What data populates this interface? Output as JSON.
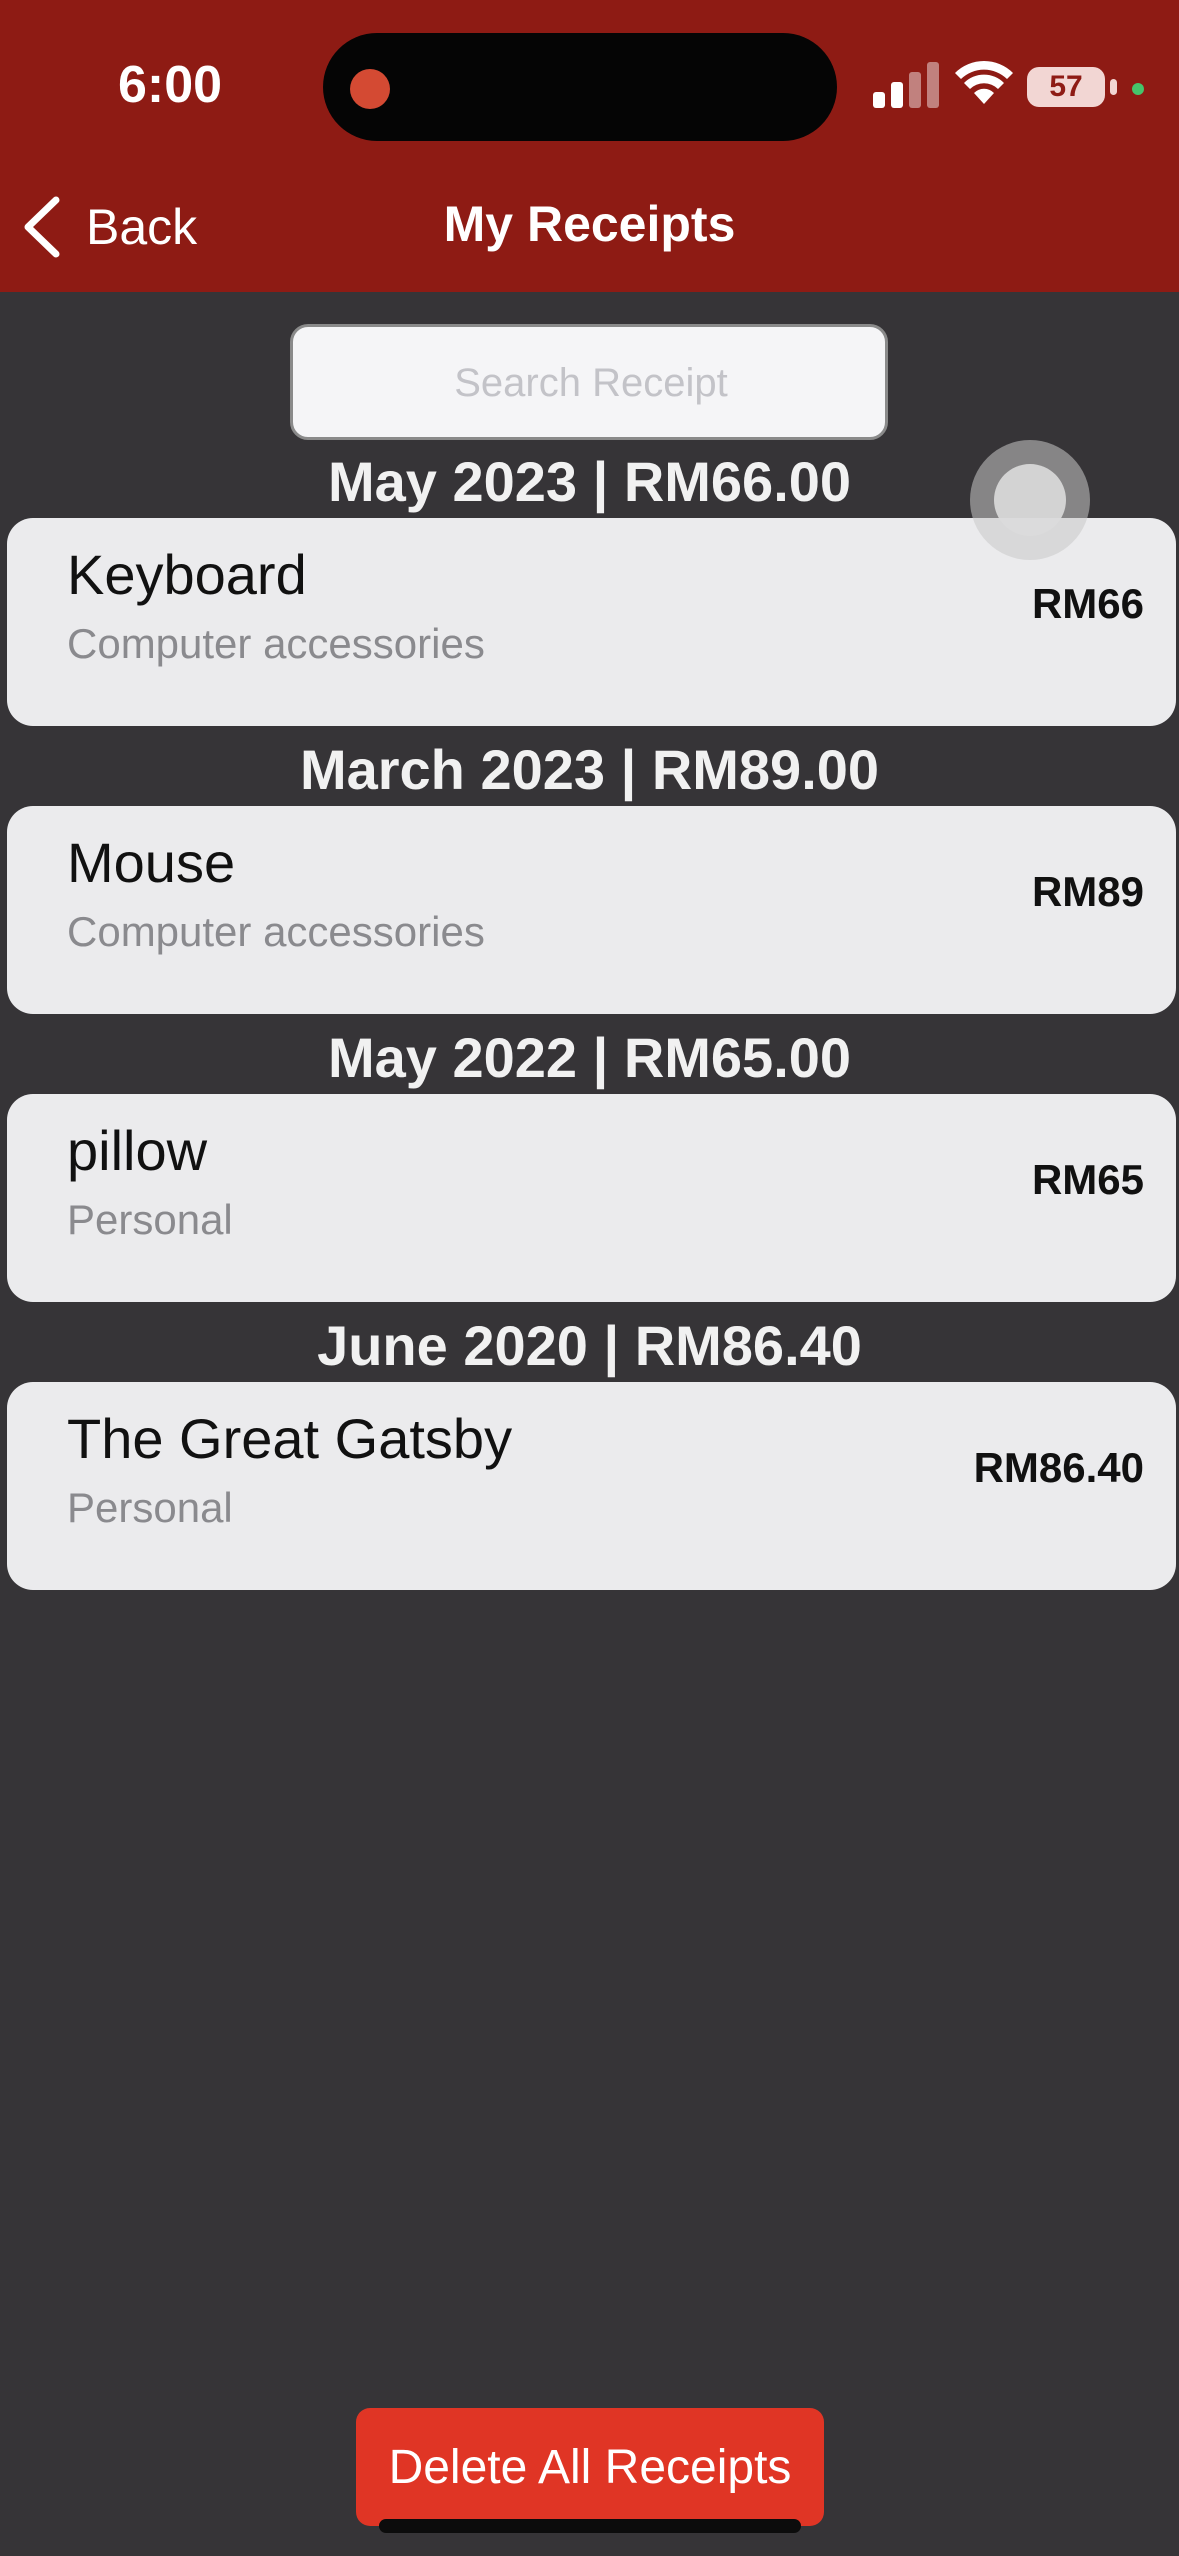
{
  "status_bar": {
    "time": "6:00",
    "battery": "57"
  },
  "nav": {
    "back_label": "Back",
    "title": "My Receipts"
  },
  "search": {
    "placeholder": "Search Receipt"
  },
  "sections": [
    {
      "header": "May 2023 | RM66.00",
      "receipt": {
        "name": "Keyboard",
        "category": "Computer accessories",
        "amount": "RM66"
      }
    },
    {
      "header": "March 2023 | RM89.00",
      "receipt": {
        "name": "Mouse",
        "category": "Computer accessories",
        "amount": "RM89"
      }
    },
    {
      "header": "May 2022 | RM65.00",
      "receipt": {
        "name": "pillow",
        "category": "Personal",
        "amount": "RM65"
      }
    },
    {
      "header": "June 2020 | RM86.40",
      "receipt": {
        "name": "The Great Gatsby",
        "category": "Personal",
        "amount": "RM86.40"
      }
    }
  ],
  "actions": {
    "delete_all_label": "Delete All Receipts"
  },
  "colors": {
    "header_bg": "#8e1b14",
    "page_bg": "#363437",
    "card_bg": "#ebebed",
    "danger": "#e03525"
  }
}
